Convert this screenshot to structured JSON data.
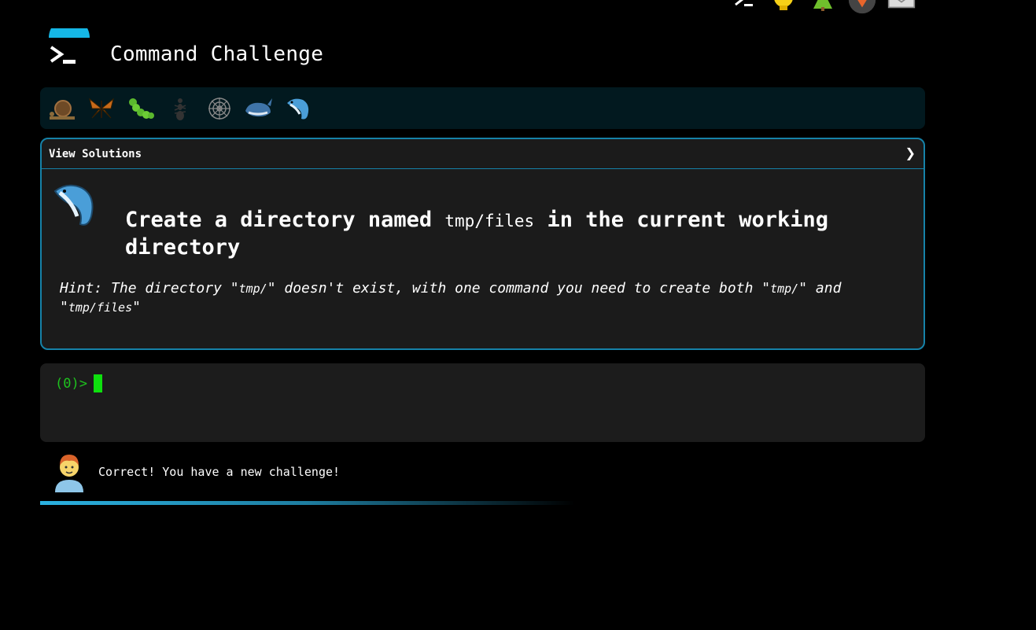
{
  "header": {
    "title": "Command Challenge",
    "top_icons": [
      "terminal-icon",
      "lightbulb-icon",
      "tree-icon",
      "gitlab-fox-icon",
      "mail-icon"
    ]
  },
  "levels": [
    "snail-icon",
    "butterfly-icon",
    "caterpillar-icon",
    "ant-icon",
    "spider-web-icon",
    "whale-icon",
    "dolphin-icon"
  ],
  "solutions": {
    "label": "View Solutions",
    "toggle": "❯"
  },
  "challenge": {
    "part1": "Create a directory named ",
    "code": "tmp/files",
    "part2": " in the current working directory"
  },
  "hint": {
    "p1": "Hint: The directory \"",
    "c1": "tmp/",
    "p2": "\" doesn't exist, with one command you need to create both \"",
    "c2": "tmp/",
    "p3": "\" and \"",
    "c3": "tmp/files",
    "p4": "\""
  },
  "terminal": {
    "prompt": "(0)>"
  },
  "status": {
    "message": "Correct! You have a new challenge!",
    "progress": 0.6
  },
  "colors": {
    "accent": "#1682a8",
    "prompt": "#1ec21e",
    "cursor": "#0ee00e"
  }
}
